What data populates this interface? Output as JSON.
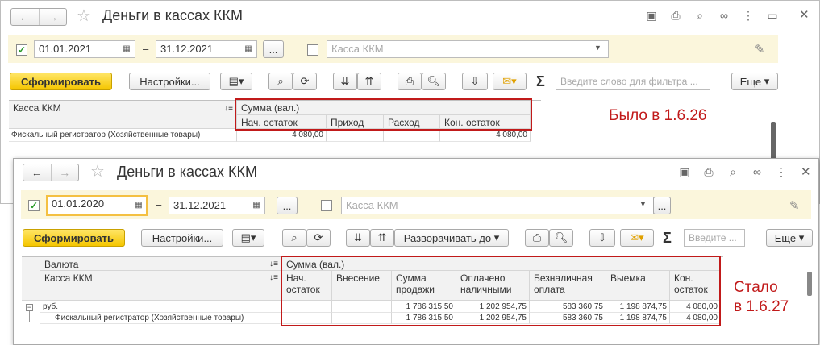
{
  "w1": {
    "title": "Деньги в кассах ККМ",
    "date_from": "01.01.2021",
    "date_to": "31.12.2021",
    "dots": "...",
    "dash": "–",
    "kassa_placeholder": "Касса ККМ",
    "generate": "Сформировать",
    "settings": "Настройки...",
    "filter_placeholder": "Введите слово для фильтра ...",
    "more": "Еще",
    "col_kassa": "Касса ККМ",
    "col_sum": "Сумма (вал.)",
    "cols": [
      "Нач. остаток",
      "Приход",
      "Расход",
      "Кон. остаток"
    ],
    "row": {
      "name": "Фискальный регистратор (Хозяйственные товары)",
      "values": [
        "4 080,00",
        "",
        "",
        "4 080,00"
      ]
    }
  },
  "w2": {
    "title": "Деньги в кассах ККМ",
    "date_from": "01.01.2020",
    "date_to": "31.12.2021",
    "dots": "...",
    "dash": "–",
    "kassa_placeholder": "Касса ККМ",
    "generate": "Сформировать",
    "settings": "Настройки...",
    "expand": "Разворачивать до",
    "filter_placeholder": "Введите ...",
    "more": "Еще",
    "col_currency": "Валюта",
    "col_kassa": "Касса ККМ",
    "col_sum": "Сумма (вал.)",
    "cols": [
      [
        "Нач.",
        "остаток"
      ],
      [
        "Внесение",
        ""
      ],
      [
        "Сумма",
        "продажи"
      ],
      [
        "Оплачено",
        "наличными"
      ],
      [
        "Безналичная",
        "оплата"
      ],
      [
        "Выемка",
        ""
      ],
      [
        "Кон.",
        "остаток"
      ]
    ],
    "rows": [
      {
        "name": "руб.",
        "values": [
          "",
          "",
          "1 786 315,50",
          "1 202 954,75",
          "583 360,75",
          "1 198 874,75",
          "4 080,00"
        ]
      },
      {
        "name": "Фискальный регистратор (Хозяйственные товары)",
        "values": [
          "",
          "",
          "1 786 315,50",
          "1 202 954,75",
          "583 360,75",
          "1 198 874,75",
          "4 080,00"
        ]
      }
    ]
  },
  "notes": {
    "before": "Было в 1.6.26",
    "after_line1": "Стало",
    "after_line2": "в 1.6.27"
  },
  "colors": {
    "accent": "#f5c600",
    "annotation": "#c11a1a"
  }
}
